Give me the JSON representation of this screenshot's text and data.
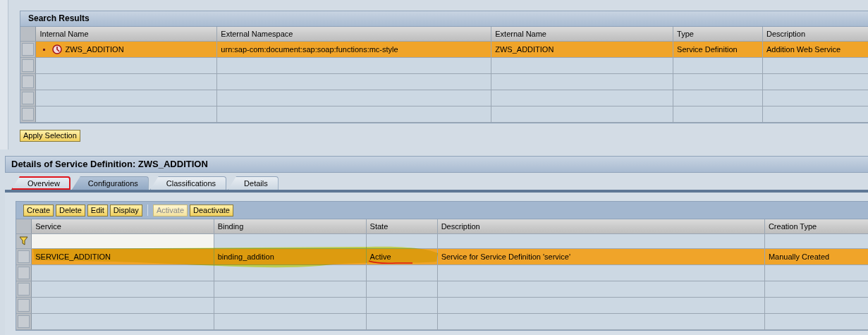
{
  "search_results": {
    "title": "Search Results",
    "columns": [
      "Internal Name",
      "External Namespace",
      "External Name",
      "Type",
      "Description"
    ],
    "rows": [
      {
        "selected": true,
        "cells": [
          "ZWS_ADDITION",
          "urn:sap-com:document:sap:soap:functions:mc-style",
          "ZWS_ADDITION",
          "Service Definition",
          "Addition Web Service"
        ]
      }
    ],
    "apply_button": "Apply Selection"
  },
  "details": {
    "title": "Details of Service Definition: ZWS_ADDITION",
    "tabs": [
      {
        "label": "Overview",
        "selected": false,
        "marked": true
      },
      {
        "label": "Configurations",
        "selected": true,
        "marked": false
      },
      {
        "label": "Classifications",
        "selected": false,
        "marked": false
      },
      {
        "label": "Details",
        "selected": false,
        "marked": false
      }
    ],
    "toolbar": [
      {
        "label": "Create",
        "disabled": false
      },
      {
        "label": "Delete",
        "disabled": false
      },
      {
        "label": "Edit",
        "disabled": false
      },
      {
        "label": "Display",
        "disabled": false
      },
      {
        "label": "Activate",
        "disabled": true
      },
      {
        "label": "Deactivate",
        "disabled": false
      }
    ],
    "columns": [
      "Service",
      "Binding",
      "State",
      "Description",
      "Creation Type"
    ],
    "rows": [
      {
        "selected": true,
        "highlighted": true,
        "cells": [
          {
            "text": "SERVICE_ADDITION",
            "underlined": false
          },
          {
            "text": "binding_addition",
            "underlined": false
          },
          {
            "text": "Active",
            "underlined": true
          },
          {
            "text": "Service for Service Definition 'service'",
            "underlined": false
          },
          {
            "text": "Manually Created",
            "underlined": false
          }
        ]
      }
    ]
  }
}
